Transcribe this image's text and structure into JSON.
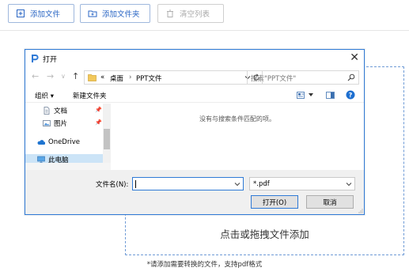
{
  "toolbar": {
    "add_file": "添加文件",
    "add_folder": "添加文件夹",
    "clear_list": "清空列表"
  },
  "dialog": {
    "title": "打开",
    "nav": {
      "back": "←",
      "forward": "→",
      "dropdown": "∨",
      "up": "↑"
    },
    "breadcrumb": {
      "prefix": "«",
      "items": [
        "桌面",
        "PPT文件"
      ],
      "separator": "›"
    },
    "search_placeholder": "搜索\"PPT文件\"",
    "commands": {
      "organize": "组织 ▾",
      "new_folder": "新建文件夹"
    },
    "nav_items": [
      {
        "label": "文档",
        "icon": "document-icon"
      },
      {
        "label": "图片",
        "icon": "picture-icon"
      },
      {
        "label": "OneDrive",
        "icon": "cloud-icon"
      },
      {
        "label": "此电脑",
        "icon": "computer-icon"
      }
    ],
    "empty_message": "没有与搜索条件匹配的项。",
    "filename_label": "文件名(N):",
    "filename_value": "",
    "filetype_value": "*.pdf",
    "open_button": "打开(O)",
    "cancel_button": "取消"
  },
  "dropzone": {
    "text": "点击或拖拽文件添加"
  },
  "footer_note": "*请添加需要转换的文件，支持pdf格式",
  "colors": {
    "accent": "#2a66c4",
    "dialog_border": "#2f7ad6",
    "dashed_border": "#6f9bd6",
    "selection": "#cce4f7"
  }
}
